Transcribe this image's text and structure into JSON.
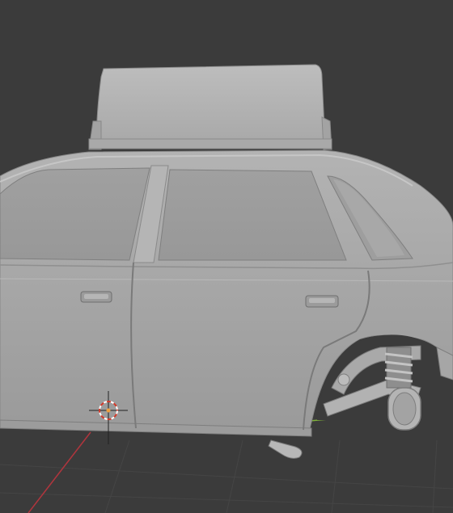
{
  "viewport": {
    "background": "#3b3b3b",
    "grid_color": "#454545",
    "x_axis_color": "#7fb03a",
    "y_axis_color": "#b0353d",
    "model_color": "#a9a9a9"
  },
  "scene": {
    "object": "car-body-mesh",
    "shading": "solid",
    "cursor_icon": "3d-cursor-icon"
  }
}
